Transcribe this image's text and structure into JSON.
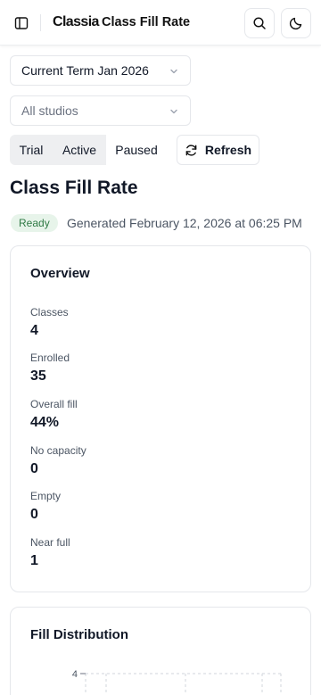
{
  "header": {
    "logo": "Classia",
    "title": "Class Fill Rate",
    "icons": [
      "sidebar-toggle-icon",
      "search-icon",
      "moon-icon"
    ]
  },
  "filters": {
    "term": "Current Term Jan 2026",
    "studio": "All studios"
  },
  "status_tabs": {
    "trial": "Trial",
    "active": "Active",
    "paused": "Paused"
  },
  "refresh_label": "Refresh",
  "page_title": "Class Fill Rate",
  "status": {
    "badge": "Ready",
    "generated": "Generated February 12, 2026 at 06:25 PM"
  },
  "overview": {
    "title": "Overview",
    "stats": [
      {
        "label": "Classes",
        "value": "4"
      },
      {
        "label": "Enrolled",
        "value": "35"
      },
      {
        "label": "Overall fill",
        "value": "44%"
      },
      {
        "label": "No capacity",
        "value": "0"
      },
      {
        "label": "Empty",
        "value": "0"
      },
      {
        "label": "Near full",
        "value": "1"
      }
    ]
  },
  "distribution": {
    "title": "Fill Distribution"
  },
  "chart_data": {
    "type": "bar",
    "yticks": [
      "4"
    ],
    "grid": true
  },
  "colors": {
    "badge_bg": "#e7f4ea",
    "badge_text": "#2f7a45",
    "border": "#e5e7eb",
    "tab_inactive": "#eeeff1"
  }
}
